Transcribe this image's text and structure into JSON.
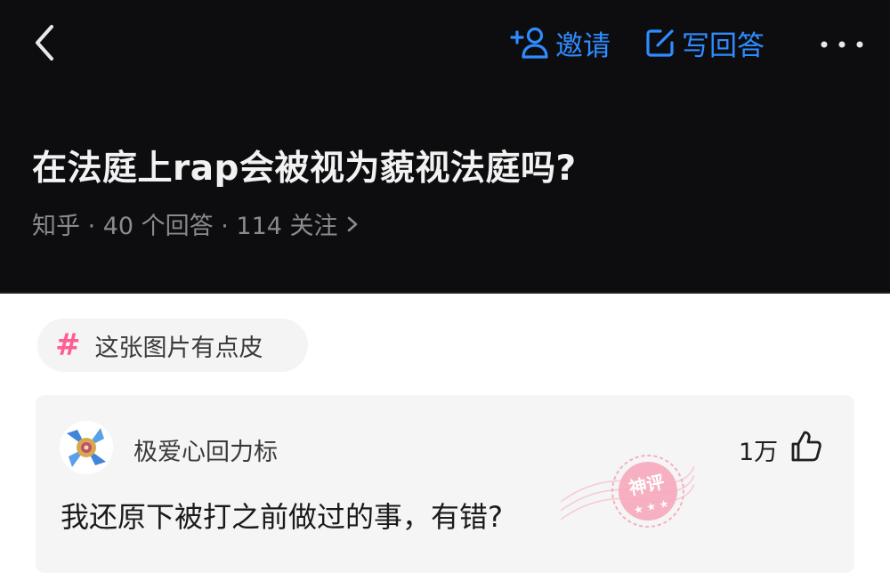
{
  "nav": {
    "invite_label": "邀请",
    "write_label": "写回答",
    "accent_color": "#2f8cff"
  },
  "question": {
    "title": "在法庭上rap会被视为藐视法庭吗?",
    "meta": "知乎 · 40 个回答 · 114 关注"
  },
  "topic": {
    "label": "这张图片有点皮",
    "icon": "hash-icon",
    "color": "#ff5c93"
  },
  "comment": {
    "username": "极爱心回力标",
    "likes": "1万",
    "text": "我还原下被打之前做过的事，有错?",
    "stamp_text": "神评"
  }
}
